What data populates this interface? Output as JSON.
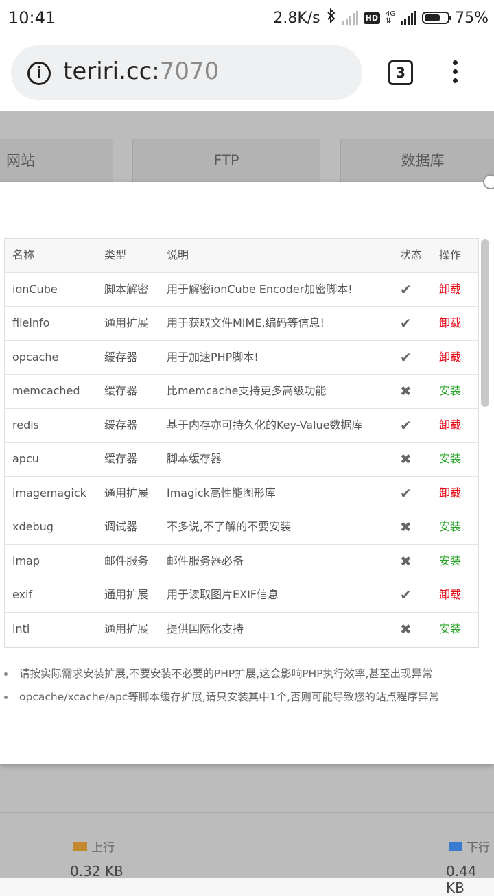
{
  "status_bar": {
    "time": "10:41",
    "net_speed": "2.8K/s",
    "hd_badge": "HD",
    "network_type": "4G",
    "battery_percent": "75%",
    "battery_level": 0.75
  },
  "browser": {
    "url_host": "teriri.cc:",
    "url_port": "7070",
    "tab_count": "3"
  },
  "background_page": {
    "tabs": [
      "网站",
      "FTP",
      "数据库"
    ],
    "legend_up": "上行",
    "legend_down": "下行",
    "up_value": "0.32 KB",
    "down_value": "0.44 KB",
    "legend_up_color": "#c48a2f",
    "legend_down_color": "#3a7ad0"
  },
  "extensions_table": {
    "headers": {
      "name": "名称",
      "type": "类型",
      "desc": "说明",
      "status": "状态",
      "op": "操作"
    },
    "rows": [
      {
        "name": "ionCube",
        "type": "脚本解密",
        "desc": "用于解密ionCube Encoder加密脚本!",
        "status": "✔",
        "op": "卸载",
        "op_kind": "uninstall"
      },
      {
        "name": "fileinfo",
        "type": "通用扩展",
        "desc": "用于获取文件MIME,编码等信息!",
        "status": "✔",
        "op": "卸载",
        "op_kind": "uninstall"
      },
      {
        "name": "opcache",
        "type": "缓存器",
        "desc": "用于加速PHP脚本!",
        "status": "✔",
        "op": "卸载",
        "op_kind": "uninstall"
      },
      {
        "name": "memcached",
        "type": "缓存器",
        "desc": "比memcache支持更多高级功能",
        "status": "✖",
        "op": "安装",
        "op_kind": "install"
      },
      {
        "name": "redis",
        "type": "缓存器",
        "desc": "基于内存亦可持久化的Key-Value数据库",
        "status": "✔",
        "op": "卸载",
        "op_kind": "uninstall"
      },
      {
        "name": "apcu",
        "type": "缓存器",
        "desc": "脚本缓存器",
        "status": "✖",
        "op": "安装",
        "op_kind": "install"
      },
      {
        "name": "imagemagick",
        "type": "通用扩展",
        "desc": "Imagick高性能图形库",
        "status": "✔",
        "op": "卸载",
        "op_kind": "uninstall"
      },
      {
        "name": "xdebug",
        "type": "调试器",
        "desc": "不多说,不了解的不要安装",
        "status": "✖",
        "op": "安装",
        "op_kind": "install"
      },
      {
        "name": "imap",
        "type": "邮件服务",
        "desc": "邮件服务器必备",
        "status": "✖",
        "op": "安装",
        "op_kind": "install"
      },
      {
        "name": "exif",
        "type": "通用扩展",
        "desc": "用于读取图片EXIF信息",
        "status": "✔",
        "op": "卸载",
        "op_kind": "uninstall"
      },
      {
        "name": "intl",
        "type": "通用扩展",
        "desc": "提供国际化支持",
        "status": "✖",
        "op": "安装",
        "op_kind": "install"
      }
    ],
    "uninstall_color": "#e60012",
    "install_color": "#2aa52a"
  },
  "notes": [
    "请按实际需求安装扩展,不要安装不必要的PHP扩展,这会影响PHP执行效率,甚至出现异常",
    "opcache/xcache/apc等脚本缓存扩展,请只安装其中1个,否则可能导致您的站点程序异常"
  ]
}
